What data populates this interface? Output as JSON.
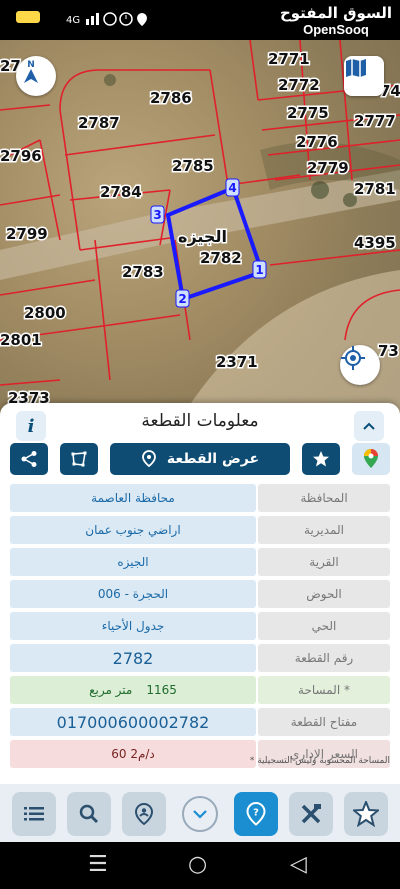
{
  "status_bar": {
    "time": "",
    "brand_ar": "السوق المفتوح",
    "brand_en": "OpenSooq"
  },
  "map": {
    "labels": {
      "p2771": "2771",
      "p2772": "2772",
      "p2786": "2786",
      "p2787": "2787",
      "p2775": "2775",
      "p2777": "2777",
      "p2796": "2796",
      "p2776": "2776",
      "p2785": "2785",
      "p2779": "2779",
      "p2784": "2784",
      "p2781": "2781",
      "p2799": "2799",
      "p4395": "4395",
      "p2782": "2782",
      "p2783": "2783",
      "p2800": "2800",
      "p2801": "2801",
      "p2371": "2371",
      "p2373": "2373",
      "edge_27": "27",
      "edge_73": "73",
      "edge_74": "74"
    },
    "plot_name": "الجيزه",
    "vertices": [
      "1",
      "2",
      "3",
      "4"
    ],
    "compass_letter": "N",
    "boundary_color": "#1a1aff"
  },
  "panel": {
    "title": "معلومات القطعة",
    "show_plot_label": "عرض القطعة",
    "rows": [
      {
        "label": "المحافظة",
        "value": "محافظة العاصمة"
      },
      {
        "label": "المديرية",
        "value": "اراضي جنوب عمان"
      },
      {
        "label": "القرية",
        "value": "الجيزه"
      },
      {
        "label": "الحوض",
        "value": "الحجرة - 006"
      },
      {
        "label": "الحي",
        "value": "جدول الأحياء"
      },
      {
        "label": "رقم القطعة",
        "value": "2782"
      },
      {
        "label": "المساحة *",
        "value_number": "1165",
        "value_unit": "متر مربع"
      },
      {
        "label": "مفتاح القطعة",
        "value": "017000600002782"
      },
      {
        "label": "السعر الإداري",
        "value": "60 د/م2"
      }
    ],
    "note": "* المساحة المحسوبة وليس التسجيلية"
  },
  "colors": {
    "primary": "#0e4c73",
    "accent": "#1a8ed0",
    "parcel_line": "#e0202a"
  }
}
